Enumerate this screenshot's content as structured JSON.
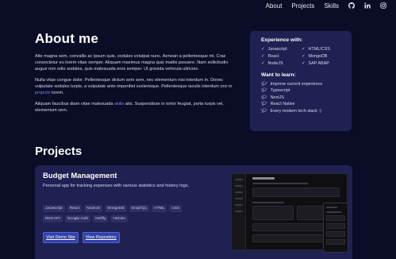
{
  "nav": {
    "items": [
      "About",
      "Projects",
      "Skills"
    ],
    "icons": [
      "github-icon",
      "linkedin-icon",
      "instagram-icon"
    ]
  },
  "about": {
    "title": "About me",
    "p1": "Alte magna sem, convallis ac ipsum quis, sodales volutpat nunc. Aenean a pellentesque mi. Cras consectetur eu lorem vitae semper. Aliquam maximus magna quis mattis posuere. Nam sollicitudin augue non odio sodales, quis malesuada eros semper. Ut gravida vehicula ultricies.",
    "p2_before": "Nulla vitae congue dolor. Pellentesque dictum sem sem, nec elementum nisi interdum in. Donec vulputate sodales turpis, a vulputate ante imperdiet scelerisque. Pellentesque iaculis interdum orci in ",
    "p2_link": "projects",
    "p2_after": " lorem.",
    "p3_before": "Aliquam faucibus diam vitae malesuada ",
    "p3_link": "skills",
    "p3_after": " atis. Suspendisse in tortor feugiat, porta turpis vel, elementum sem."
  },
  "experience": {
    "title": "Experience with:",
    "items": [
      "Javascript",
      "HTML/CSS",
      "React",
      "MongoDB",
      "NodeJS",
      "SAP ABAP"
    ]
  },
  "learn": {
    "title": "Want to learn:",
    "items": [
      "Improve current experience",
      "Typescript",
      "NextJS",
      "React Native",
      "Every modern tech stack :)"
    ]
  },
  "projects": {
    "title": "Projects",
    "cards": [
      {
        "name": "Budget Management",
        "description": "Personal app for tracking expenses with various statistics and history logs.",
        "tags": [
          "Javascript",
          "React",
          "NodeJS",
          "MongoDB",
          "GraphQL",
          "HTML",
          "CSS",
          "Rest API",
          "Google Auth",
          "Netlify",
          "Heroku"
        ],
        "demo_label": "Visit Demo Site",
        "repo_label": "View Repository"
      }
    ]
  },
  "colors": {
    "background": "#0b0c25",
    "card": "#1e2152",
    "link": "#6b8cff",
    "button": "#3141a8"
  }
}
